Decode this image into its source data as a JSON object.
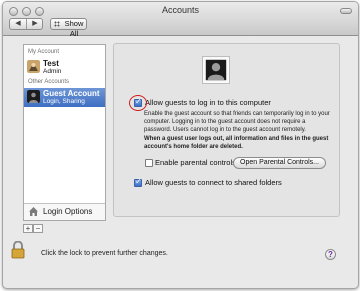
{
  "window": {
    "title": "Accounts"
  },
  "toolbar": {
    "back_glyph": "◀",
    "forward_glyph": "▶",
    "show_all_label": "Show All"
  },
  "sidebar": {
    "my_account_header": "My Account",
    "other_accounts_header": "Other Accounts",
    "accounts": [
      {
        "name": "Test",
        "sub": "Admin",
        "icon": "user-avatar-icon",
        "selected": false
      },
      {
        "name": "Guest Account",
        "sub": "Login, Sharing",
        "icon": "guest-silhouette-icon",
        "selected": true
      }
    ],
    "login_options_label": "Login Options",
    "add_glyph": "+",
    "remove_glyph": "−"
  },
  "guest": {
    "allow_login": {
      "label": "Allow guests to log in to this computer",
      "checked": true
    },
    "description": "Enable the guest account so that friends can temporarily log in to your computer. Logging in to the guest account does not require a password. Users cannot log in to the guest account remotely.",
    "warning": "When a guest user logs out, all information and files in the guest account's home folder are deleted.",
    "parental_controls": {
      "label": "Enable parental controls",
      "checked": false
    },
    "open_parental_controls_label": "Open Parental Controls...",
    "shared_folders": {
      "label": "Allow guests to connect to shared folders",
      "checked": true
    }
  },
  "footer": {
    "lock_message": "Click the lock to prevent further changes.",
    "help_glyph": "?"
  },
  "colors": {
    "selection": "#3e6fc2",
    "annotation_circle": "#d01a1a"
  }
}
